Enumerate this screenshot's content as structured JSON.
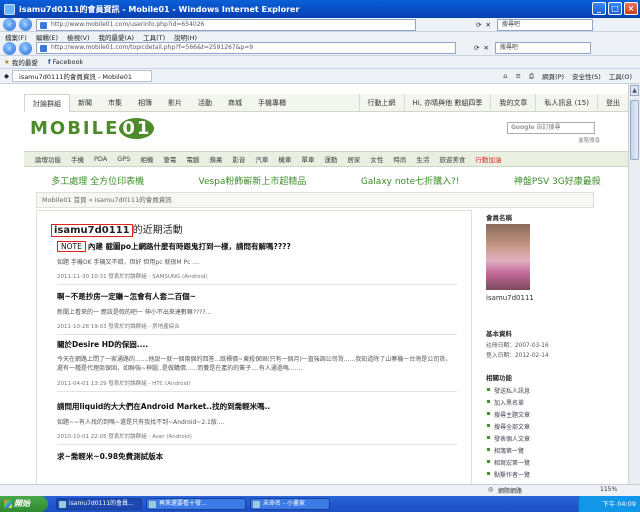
{
  "window": {
    "title": "isamu7d0111的會員資訊 - Mobile01 - Windows Internet Explorer",
    "min": "_",
    "max": "□",
    "close": "×"
  },
  "browser": {
    "address1": "http://www.mobile01.com/userinfo.php?id=654026",
    "search1": "搜尋吧",
    "menu": [
      "檔案(F)",
      "編輯(E)",
      "檢視(V)",
      "我的最愛(A)",
      "工具(T)",
      "說明(H)"
    ],
    "address2": "http://www.mobile01.com/topicdetail.php?f=566&t=2591267&p=9",
    "search2": "搜尋吧",
    "favorites": "我的最愛",
    "fav_facebook": "Facebook",
    "tab": "isamu7d0111的會員資訊 - Mobile01",
    "tools": [
      "網頁(P)",
      "安全性(S)",
      "工具(O)"
    ]
  },
  "site": {
    "topnav": [
      "討論群組",
      "新聞",
      "市集",
      "相簿",
      "影片",
      "活動",
      "商城",
      "手機專櫃"
    ],
    "rightnav": [
      "行動上網",
      "Hi, 亦晴與他 數組四季",
      "我的文章",
      "私人訊息 (15)",
      "登出"
    ],
    "logo_main": "MOBILE",
    "logo_end": "01",
    "search_google": "Google",
    "search_placeholder": "自訂搜尋",
    "advanced": "進階搜尋",
    "categories": [
      "論壇功能",
      "手機",
      "PDA",
      "GPS",
      "相機",
      "筆電",
      "電腦",
      "蘋果",
      "影音",
      "汽車",
      "機車",
      "單車",
      "運動",
      "居家",
      "女性",
      "時尚",
      "生活",
      "旅遊美食"
    ],
    "categories_hot": "行動加油",
    "ads": [
      "多工處理 全方位印表機",
      "Vespa粉飾嶄新上市超精品",
      "Galaxy note七折購入?!",
      "神盤PSV 3G好康最殺"
    ],
    "breadcrumb": "Mobile01 首頁 » isamu7d0111的會員資訊",
    "activity_user": "isamu7d0111",
    "activity_rest": "的近期活動",
    "posts": [
      {
        "tag": "NOTE",
        "title": "內建 截圖po上網路什麼有時跟鬼打到一樣，請問有解嗎????",
        "excerpt": "如題 手機OK 手機又不錯，但好 但用pc 就很M Pc ....",
        "meta": "2011-11-30 10:31 發表於討論群組 - SAMSUNG (Android)"
      },
      {
        "tag": "",
        "title": "啊~不是抄房一定賺~怎會有人套二百個~",
        "excerpt": "新聞上看來的一 應該是假的吧一 伸小不出來達數嘛????...",
        "meta": "2011-10-28 19:03 發表於討論群組 - 房地產綜合"
      },
      {
        "tag": "",
        "title": "關於Desire HD的保固....",
        "excerpt": "今天在網路上問了一家通路的.......他說一就一個兩個的回答...既標價~東殺保固(只有一個月)一直強調公司貨......我知道除了山寨機一台灣是公司貨，還有一種是代理商保固，如聯強~神腦..是做購價......而雙是在產的的簽子....有人通過嗎.......",
        "meta": "2011-04-01 13:29 發表於討論群組 - HTC (Android)"
      },
      {
        "tag": "",
        "title": "請問用liquid的大大們在Android Market..找的到喬輕米嗎..",
        "excerpt": "如題~~有人找的到嗎~還是只有我找不到~Android~2.1版....",
        "meta": "2010-10-01 22:05 發表於討論群組 - Acer (Android)"
      },
      {
        "tag": "",
        "title": "求~喬輕米~0.98免費測試版本",
        "excerpt": "",
        "meta": ""
      }
    ],
    "side": {
      "member_label": "會員名稱",
      "username": "isamu7d0111",
      "basic_label": "基本資料",
      "register": "註冊日期：2007-03-16",
      "lastlogin": "登入日期：2012-02-14",
      "functions_label": "相關功能",
      "links": [
        "發送私人訊息",
        "加入黑名單",
        "搜尋主題文章",
        "搜尋全部文章",
        "發表個人文章",
        "相簿第一覽",
        "相寫宏第一覽",
        "點擊作者一覽"
      ]
    }
  },
  "statusbar": {
    "zone": "網際網路",
    "zoom": "115%"
  },
  "taskbar": {
    "start": "開始",
    "tasks": [
      "isamu7d0111的會員...",
      "再來還要看十發...",
      "未命名 - 小畫家"
    ],
    "clock": "下午 04:09"
  }
}
